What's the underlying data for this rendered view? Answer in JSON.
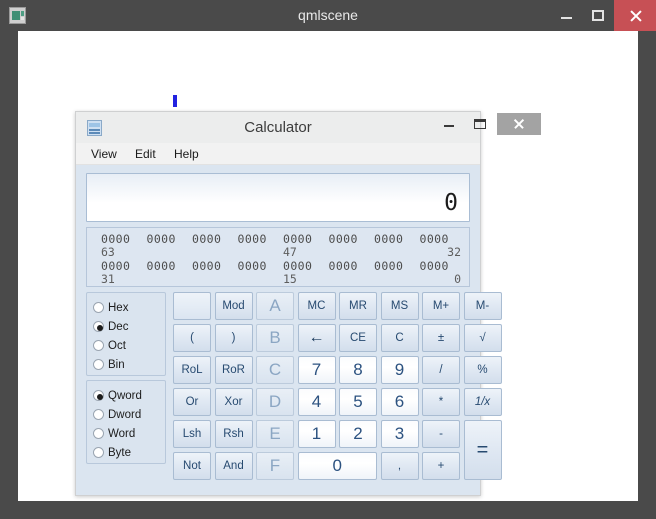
{
  "outer_window": {
    "title": "qmlscene",
    "icon_name": "qmlscene-app-icon",
    "controls": {
      "minimize": "–",
      "maximize": "☐",
      "close": "×"
    },
    "colors": {
      "titlebar": "#4a4a4a",
      "close_button": "#c75055",
      "client": "#ffffff",
      "title_text": "#e9e9e9"
    }
  },
  "cursor": {
    "name": "text-cursor",
    "color": "#2222e0"
  },
  "calculator": {
    "title": "Calculator",
    "icon_name": "calculator-app-icon",
    "controls": {
      "minimize": "–",
      "maximize": "☐",
      "close": "×"
    },
    "menu": [
      {
        "label": "View"
      },
      {
        "label": "Edit"
      },
      {
        "label": "Help"
      }
    ],
    "display": {
      "value": "0"
    },
    "bit_panel": {
      "nibbles_row1": [
        "0000",
        "0000",
        "0000",
        "0000",
        "0000",
        "0000",
        "0000",
        "0000"
      ],
      "labels_row1": [
        {
          "text": "63",
          "align": "left"
        },
        {
          "text": "47",
          "align": "mid"
        },
        {
          "text": "32",
          "align": "right"
        }
      ],
      "nibbles_row2": [
        "0000",
        "0000",
        "0000",
        "0000",
        "0000",
        "0000",
        "0000",
        "0000"
      ],
      "labels_row2": [
        {
          "text": "31",
          "align": "left"
        },
        {
          "text": "15",
          "align": "mid"
        },
        {
          "text": "0",
          "align": "right"
        }
      ]
    },
    "base_radios": [
      {
        "label": "Hex",
        "selected": false
      },
      {
        "label": "Dec",
        "selected": true
      },
      {
        "label": "Oct",
        "selected": false
      },
      {
        "label": "Bin",
        "selected": false
      }
    ],
    "size_radios": [
      {
        "label": "Qword",
        "selected": true
      },
      {
        "label": "Dword",
        "selected": false
      },
      {
        "label": "Word",
        "selected": false
      },
      {
        "label": "Byte",
        "selected": false
      }
    ],
    "logic_buttons": [
      {
        "label": "",
        "name": "blank-button"
      },
      {
        "label": "Mod",
        "name": "mod-button"
      },
      {
        "label": "(",
        "name": "open-paren-button"
      },
      {
        "label": ")",
        "name": "close-paren-button"
      },
      {
        "label": "RoL",
        "name": "rol-button"
      },
      {
        "label": "RoR",
        "name": "ror-button"
      },
      {
        "label": "Or",
        "name": "or-button"
      },
      {
        "label": "Xor",
        "name": "xor-button"
      },
      {
        "label": "Lsh",
        "name": "lsh-button"
      },
      {
        "label": "Rsh",
        "name": "rsh-button"
      },
      {
        "label": "Not",
        "name": "not-button"
      },
      {
        "label": "And",
        "name": "and-button"
      }
    ],
    "hex_letters": [
      {
        "label": "A",
        "name": "hex-a-button"
      },
      {
        "label": "B",
        "name": "hex-b-button"
      },
      {
        "label": "C",
        "name": "hex-c-button"
      },
      {
        "label": "D",
        "name": "hex-d-button"
      },
      {
        "label": "E",
        "name": "hex-e-button"
      },
      {
        "label": "F",
        "name": "hex-f-button"
      }
    ],
    "memory_buttons": [
      {
        "label": "MC",
        "name": "memory-clear-button"
      },
      {
        "label": "MR",
        "name": "memory-recall-button"
      },
      {
        "label": "MS",
        "name": "memory-store-button"
      },
      {
        "label": "M+",
        "name": "memory-add-button"
      },
      {
        "label": "M-",
        "name": "memory-subtract-button"
      }
    ],
    "edit_buttons": [
      {
        "label": "←",
        "name": "backspace-button"
      },
      {
        "label": "CE",
        "name": "clear-entry-button"
      },
      {
        "label": "C",
        "name": "clear-button"
      },
      {
        "label": "±",
        "name": "sign-toggle-button"
      },
      {
        "label": "√",
        "name": "sqrt-button"
      }
    ],
    "digits": [
      {
        "label": "7",
        "name": "digit-7-button"
      },
      {
        "label": "8",
        "name": "digit-8-button"
      },
      {
        "label": "9",
        "name": "digit-9-button"
      },
      {
        "label": "4",
        "name": "digit-4-button"
      },
      {
        "label": "5",
        "name": "digit-5-button"
      },
      {
        "label": "6",
        "name": "digit-6-button"
      },
      {
        "label": "1",
        "name": "digit-1-button"
      },
      {
        "label": "2",
        "name": "digit-2-button"
      },
      {
        "label": "3",
        "name": "digit-3-button"
      },
      {
        "label": "0",
        "name": "digit-0-button"
      }
    ],
    "operators": [
      {
        "label": "/",
        "name": "divide-button"
      },
      {
        "label": "%",
        "name": "percent-button"
      },
      {
        "label": "*",
        "name": "multiply-button"
      },
      {
        "label": "1/x",
        "name": "reciprocal-button"
      },
      {
        "label": "-",
        "name": "minus-button"
      },
      {
        "label": "+",
        "name": "plus-button"
      },
      {
        "label": ",",
        "name": "decimal-separator-button"
      },
      {
        "label": "=",
        "name": "equals-button"
      }
    ]
  }
}
